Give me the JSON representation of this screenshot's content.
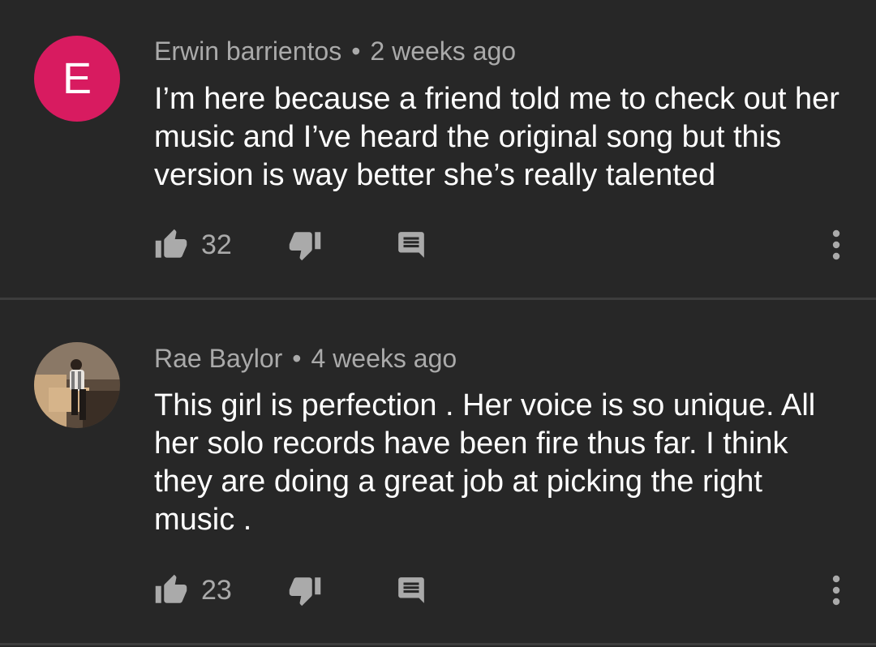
{
  "comments": [
    {
      "avatar_letter": "E",
      "avatar_color": "#d81b60",
      "author": "Erwin barrientos",
      "separator": "•",
      "time": "2 weeks ago",
      "text": "I’m here because a friend told me to check out her music and I’ve heard the original song but this version is way better she’s really talented",
      "likes": "32"
    },
    {
      "avatar_letter": "",
      "author": "Rae Baylor",
      "separator": "•",
      "time": "4 weeks ago",
      "text": "This girl is perfection . Her voice is so unique. All her solo records have been fire thus far. I think they are doing a great job at picking the right music .",
      "likes": "23"
    }
  ],
  "icons": {
    "like": "thumb-up-icon",
    "dislike": "thumb-down-icon",
    "reply": "reply-comment-icon",
    "menu": "more-vertical-icon"
  },
  "colors": {
    "background": "#272727",
    "secondary_text": "#aaaaaa",
    "primary_text": "#ffffff"
  }
}
